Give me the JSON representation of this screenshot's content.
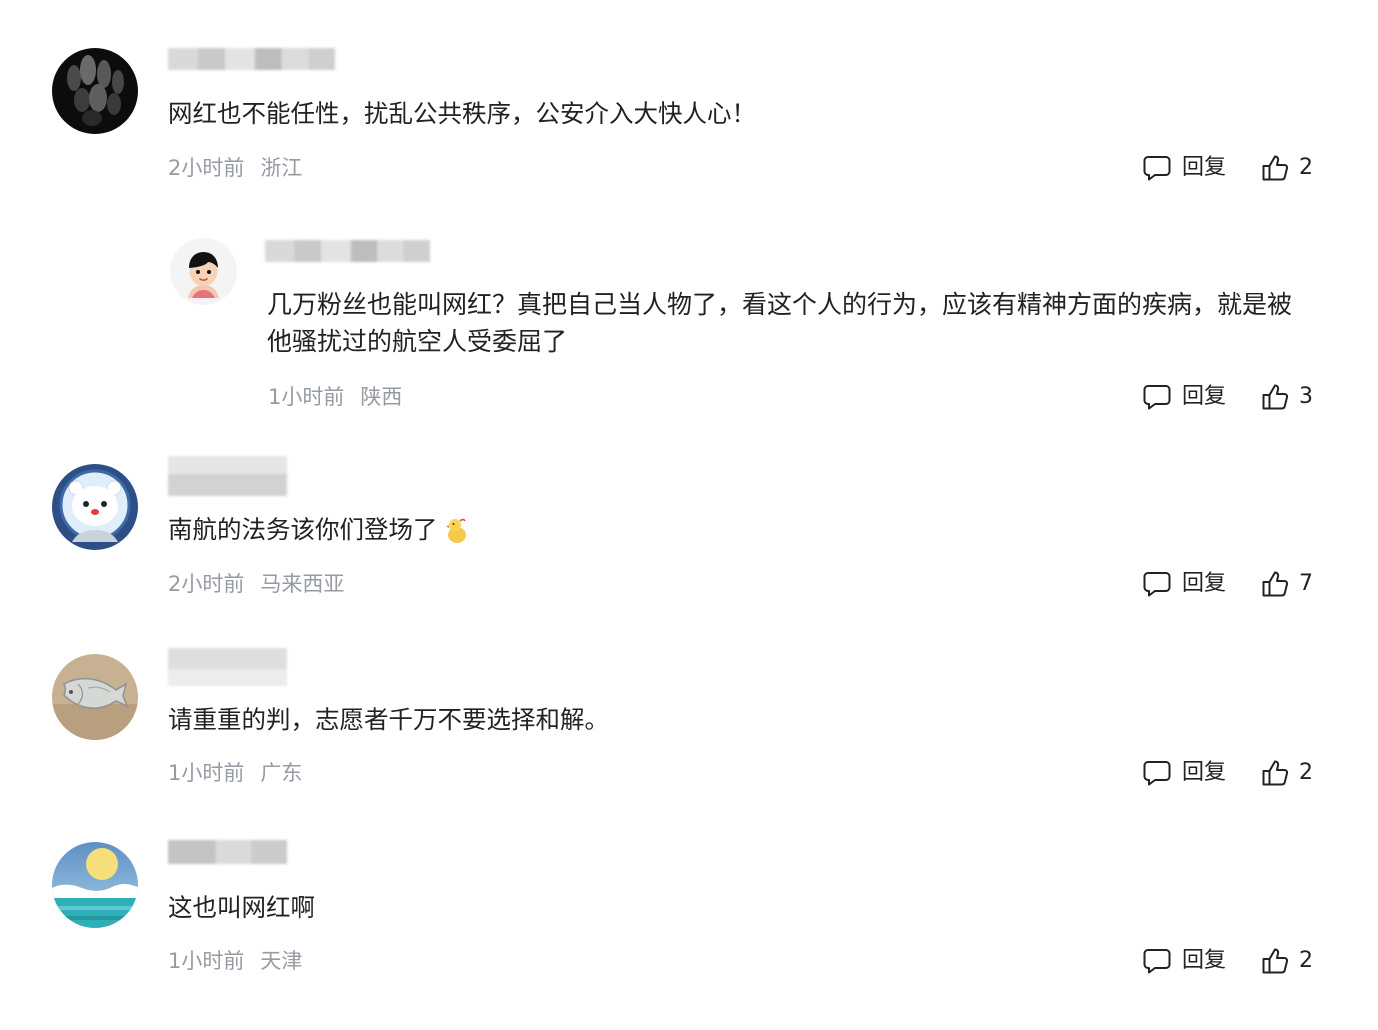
{
  "comments": [
    {
      "text": "网红也不能任性，扰乱公共秩序，公安介入大快人心！",
      "time": "2小时前",
      "location": "浙江",
      "reply_label": "回复",
      "likes": "2"
    },
    {
      "text": "几万粉丝也能叫网红？真把自己当人物了，看这个人的行为，应该有精神方面的疾病，就是被他骚扰过的航空人受委屈了",
      "time": "1小时前",
      "location": "陕西",
      "reply_label": "回复",
      "likes": "3"
    },
    {
      "text": "南航的法务该你们登场了",
      "time": "2小时前",
      "location": "马来西亚",
      "reply_label": "回复",
      "likes": "7"
    },
    {
      "text": "请重重的判，志愿者千万不要选择和解。",
      "time": "1小时前",
      "location": "广东",
      "reply_label": "回复",
      "likes": "2"
    },
    {
      "text": "这也叫网红啊",
      "time": "1小时前",
      "location": "天津",
      "reply_label": "回复",
      "likes": "2"
    }
  ],
  "icons": {
    "reply": "comment-bubble-icon",
    "like": "thumbs-up-icon",
    "emoji": "duck-emoji-icon"
  }
}
